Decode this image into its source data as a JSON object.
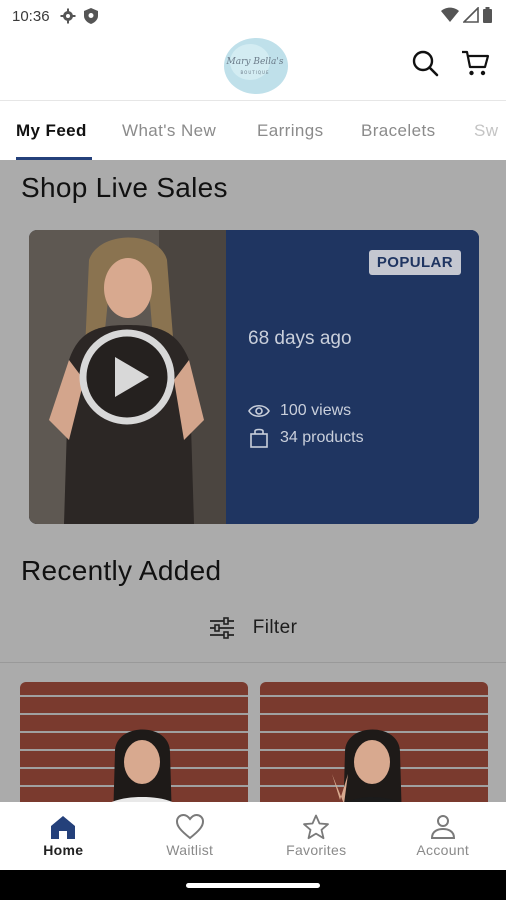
{
  "status_bar": {
    "time": "10:36"
  },
  "header": {
    "logo_text": "Mary Bella's",
    "logo_subtext": "BOUTIQUE"
  },
  "tabs": [
    {
      "label": "My Feed",
      "active": true
    },
    {
      "label": "What's New",
      "active": false
    },
    {
      "label": "Earrings",
      "active": false
    },
    {
      "label": "Bracelets",
      "active": false
    },
    {
      "label": "Sw",
      "active": false
    }
  ],
  "live_section": {
    "title": "Shop Live Sales",
    "card": {
      "badge": "POPULAR",
      "posted": "68 days ago",
      "views": "100 views",
      "products": "34 products"
    }
  },
  "recent_section": {
    "title": "Recently Added",
    "filter_label": "Filter"
  },
  "bottom_nav": [
    {
      "label": "Home",
      "icon": "home-icon",
      "active": true
    },
    {
      "label": "Waitlist",
      "icon": "heart-icon",
      "active": false
    },
    {
      "label": "Favorites",
      "icon": "star-icon",
      "active": false
    },
    {
      "label": "Account",
      "icon": "person-icon",
      "active": false
    }
  ],
  "colors": {
    "accent": "#24407a",
    "card_bg": "#1f3561",
    "overlay_bg": "#ababab"
  }
}
